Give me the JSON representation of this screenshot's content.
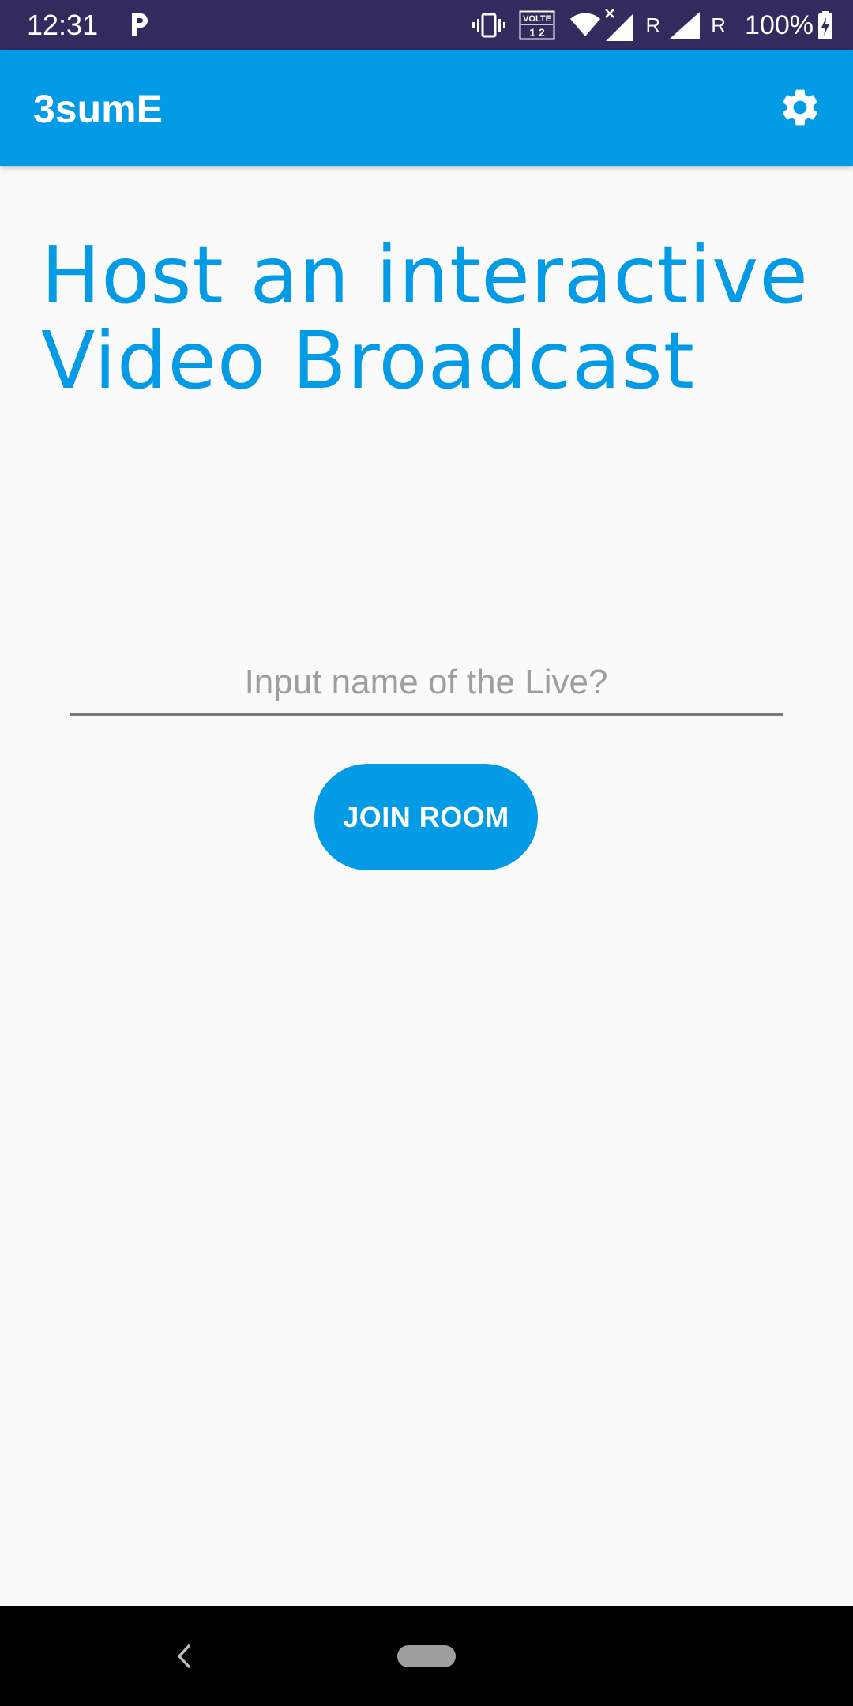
{
  "status_bar": {
    "time": "12:31",
    "app_notification_icon": "p-letter-icon",
    "volte_label": "VOLTE",
    "sim_label": "1 2",
    "roaming_1": "R",
    "roaming_2": "R",
    "battery_percent": "100%",
    "icons": [
      "vibrate-icon",
      "volte-icon",
      "wifi-icon",
      "signal-no-data-icon",
      "signal-icon",
      "battery-charging-icon"
    ]
  },
  "app_bar": {
    "title": "3sumE",
    "settings_icon": "gear-icon",
    "background_color": "#039BE5"
  },
  "main": {
    "headline_line1": "Host an interactive",
    "headline_line2": "Video Broadcast",
    "live_name_input": {
      "value": "",
      "placeholder": "Input name of the Live?"
    },
    "join_button_label": "JOIN ROOM",
    "accent_color": "#039BE5"
  },
  "nav_bar": {
    "back_icon": "chevron-left-icon",
    "home_icon": "home-pill-icon"
  }
}
